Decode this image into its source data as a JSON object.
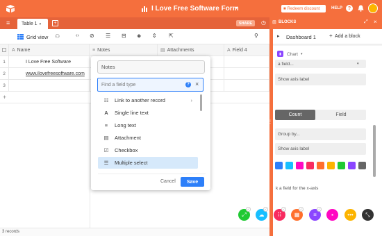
{
  "app": {
    "title": "I Love Free Software Form",
    "redeem_label": "Redeem discount",
    "help_label": "HELP"
  },
  "tabs": {
    "table_tab": "Table 1",
    "share_label": "SHARE",
    "blocks_label": "BLOCKS"
  },
  "toolbar": {
    "view_label": "Grid view"
  },
  "grid": {
    "columns": [
      "Name",
      "Notes",
      "Attachments",
      "Field 4"
    ],
    "rows": [
      {
        "num": "1",
        "name": "I Love Free Software"
      },
      {
        "num": "2",
        "name": "www.ilovefreesoftware.com"
      },
      {
        "num": "3",
        "name": ""
      }
    ],
    "add_row": "+",
    "record_count": "3 records"
  },
  "field_editor": {
    "field_name": "Notes",
    "search_placeholder": "Find a field type",
    "help_icon": "?",
    "types": [
      {
        "label": "Link to another record",
        "icon": "list-icon"
      },
      {
        "label": "Single line text",
        "icon": "text-icon"
      },
      {
        "label": "Long text",
        "icon": "paragraph-icon"
      },
      {
        "label": "Attachment",
        "icon": "paperclip-icon"
      },
      {
        "label": "Checkbox",
        "icon": "checkbox-icon"
      },
      {
        "label": "Multiple select",
        "icon": "multiselect-icon"
      }
    ],
    "cancel_label": "Cancel",
    "save_label": "Save"
  },
  "dashboard": {
    "title": "Dashboard 1",
    "add_block": "Add a block",
    "chart_label": "Chart",
    "field_select": "a field...",
    "show_axis_label_1": "Show axis label",
    "count_label": "Count",
    "field_label": "Field",
    "group_by": "Group by...",
    "show_axis_label_2": "Show axis label",
    "x_axis_hint": "k a field for the x-axis",
    "colors": [
      "#2d7ff9",
      "#18bfff",
      "#ff08c2",
      "#f82b60",
      "#ff6f2c",
      "#fcb400",
      "#20c933",
      "#8b46ff",
      "#666666"
    ]
  },
  "fab_colors": [
    "#20c933",
    "#18bfff",
    "#f82b60",
    "#ff6f2c",
    "#8b46ff",
    "#ff08c2",
    "#fcb400",
    "#333333"
  ]
}
